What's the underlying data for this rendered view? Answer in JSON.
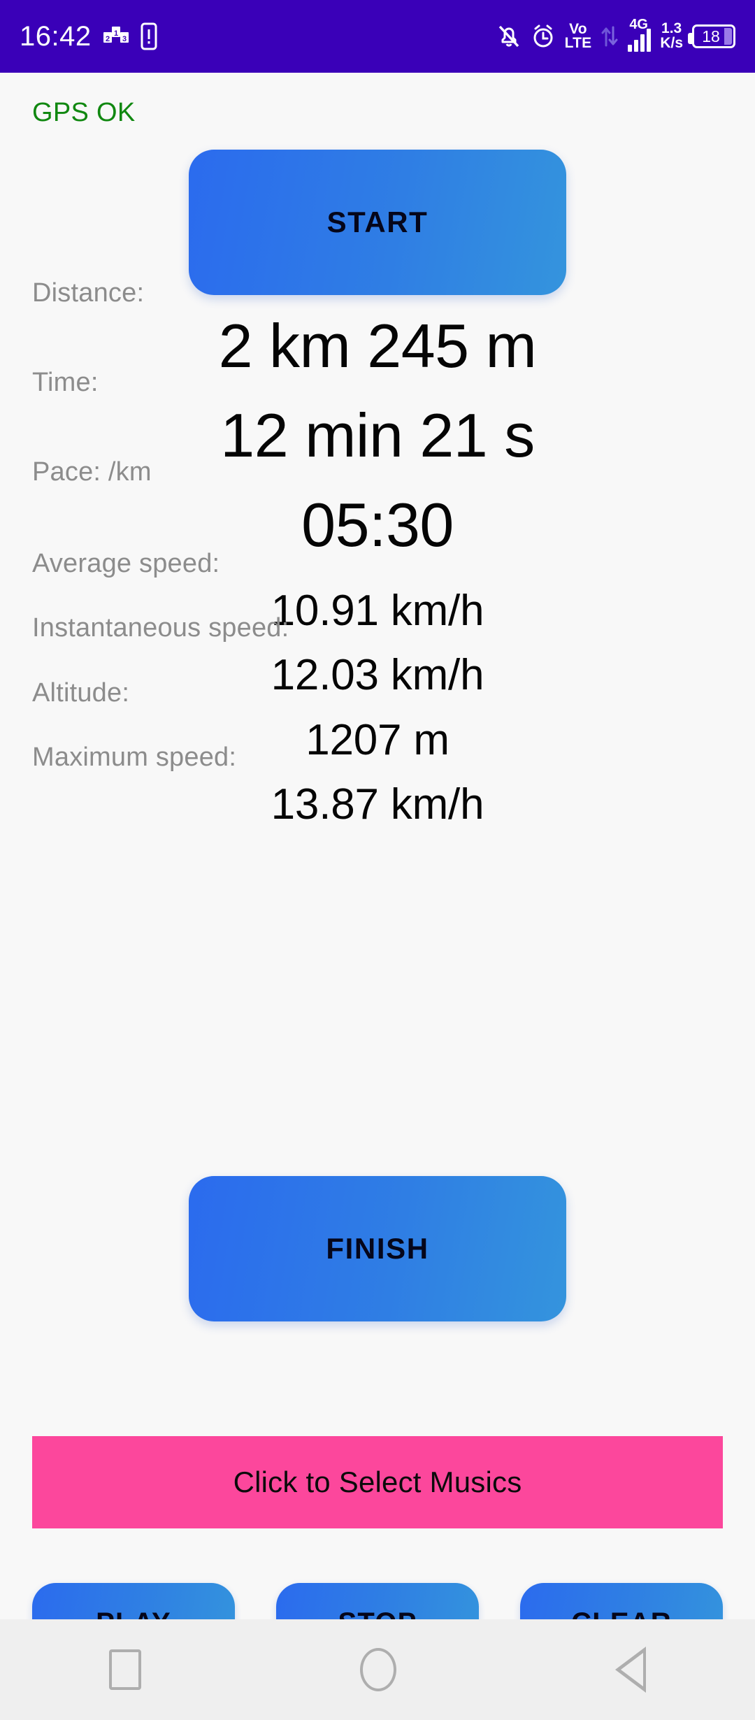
{
  "status_bar": {
    "time": "16:42",
    "icons_left": [
      "podium-leaderboard-icon",
      "sim-card-icon"
    ],
    "icons_right": [
      "bell-off-icon",
      "alarm-icon",
      "volte-icon",
      "data-transfer-icon",
      "signal-4g-icon",
      "network-speed-icon",
      "battery-icon"
    ],
    "volte_top": "Vo",
    "volte_bottom": "LTE",
    "network_type": "4G",
    "net_speed_value": "1.3",
    "net_speed_unit": "K/s",
    "battery_level": "18",
    "background_color": "#3a00b8"
  },
  "app": {
    "gps_status": "GPS OK",
    "gps_color": "#118811",
    "start_button": "START",
    "finish_button": "FINISH",
    "music_select_button": "Click to Select Musics",
    "music_bar_color": "#fc479c",
    "button_gradient_from": "#2b6bee",
    "button_gradient_to": "#3494dd",
    "metrics": [
      {
        "label": "Distance:",
        "value": "2 km 245 m"
      },
      {
        "label": "Time:",
        "value": "12 min 21 s"
      },
      {
        "label": "Pace: /km",
        "value": "05:30"
      },
      {
        "label": "Average speed:",
        "value": "10.91 km/h"
      },
      {
        "label": "Instantaneous speed:",
        "value": "12.03 km/h"
      },
      {
        "label": "Altitude:",
        "value": "1207 m"
      },
      {
        "label": "Maximum speed:",
        "value": "13.87 km/h"
      }
    ],
    "media_controls": [
      {
        "label": "PLAY"
      },
      {
        "label": "STOP"
      },
      {
        "label": "CLEAR"
      }
    ]
  },
  "nav_bar": {
    "recents": "recents-square-icon",
    "home": "home-circle-icon",
    "back": "back-triangle-icon"
  }
}
